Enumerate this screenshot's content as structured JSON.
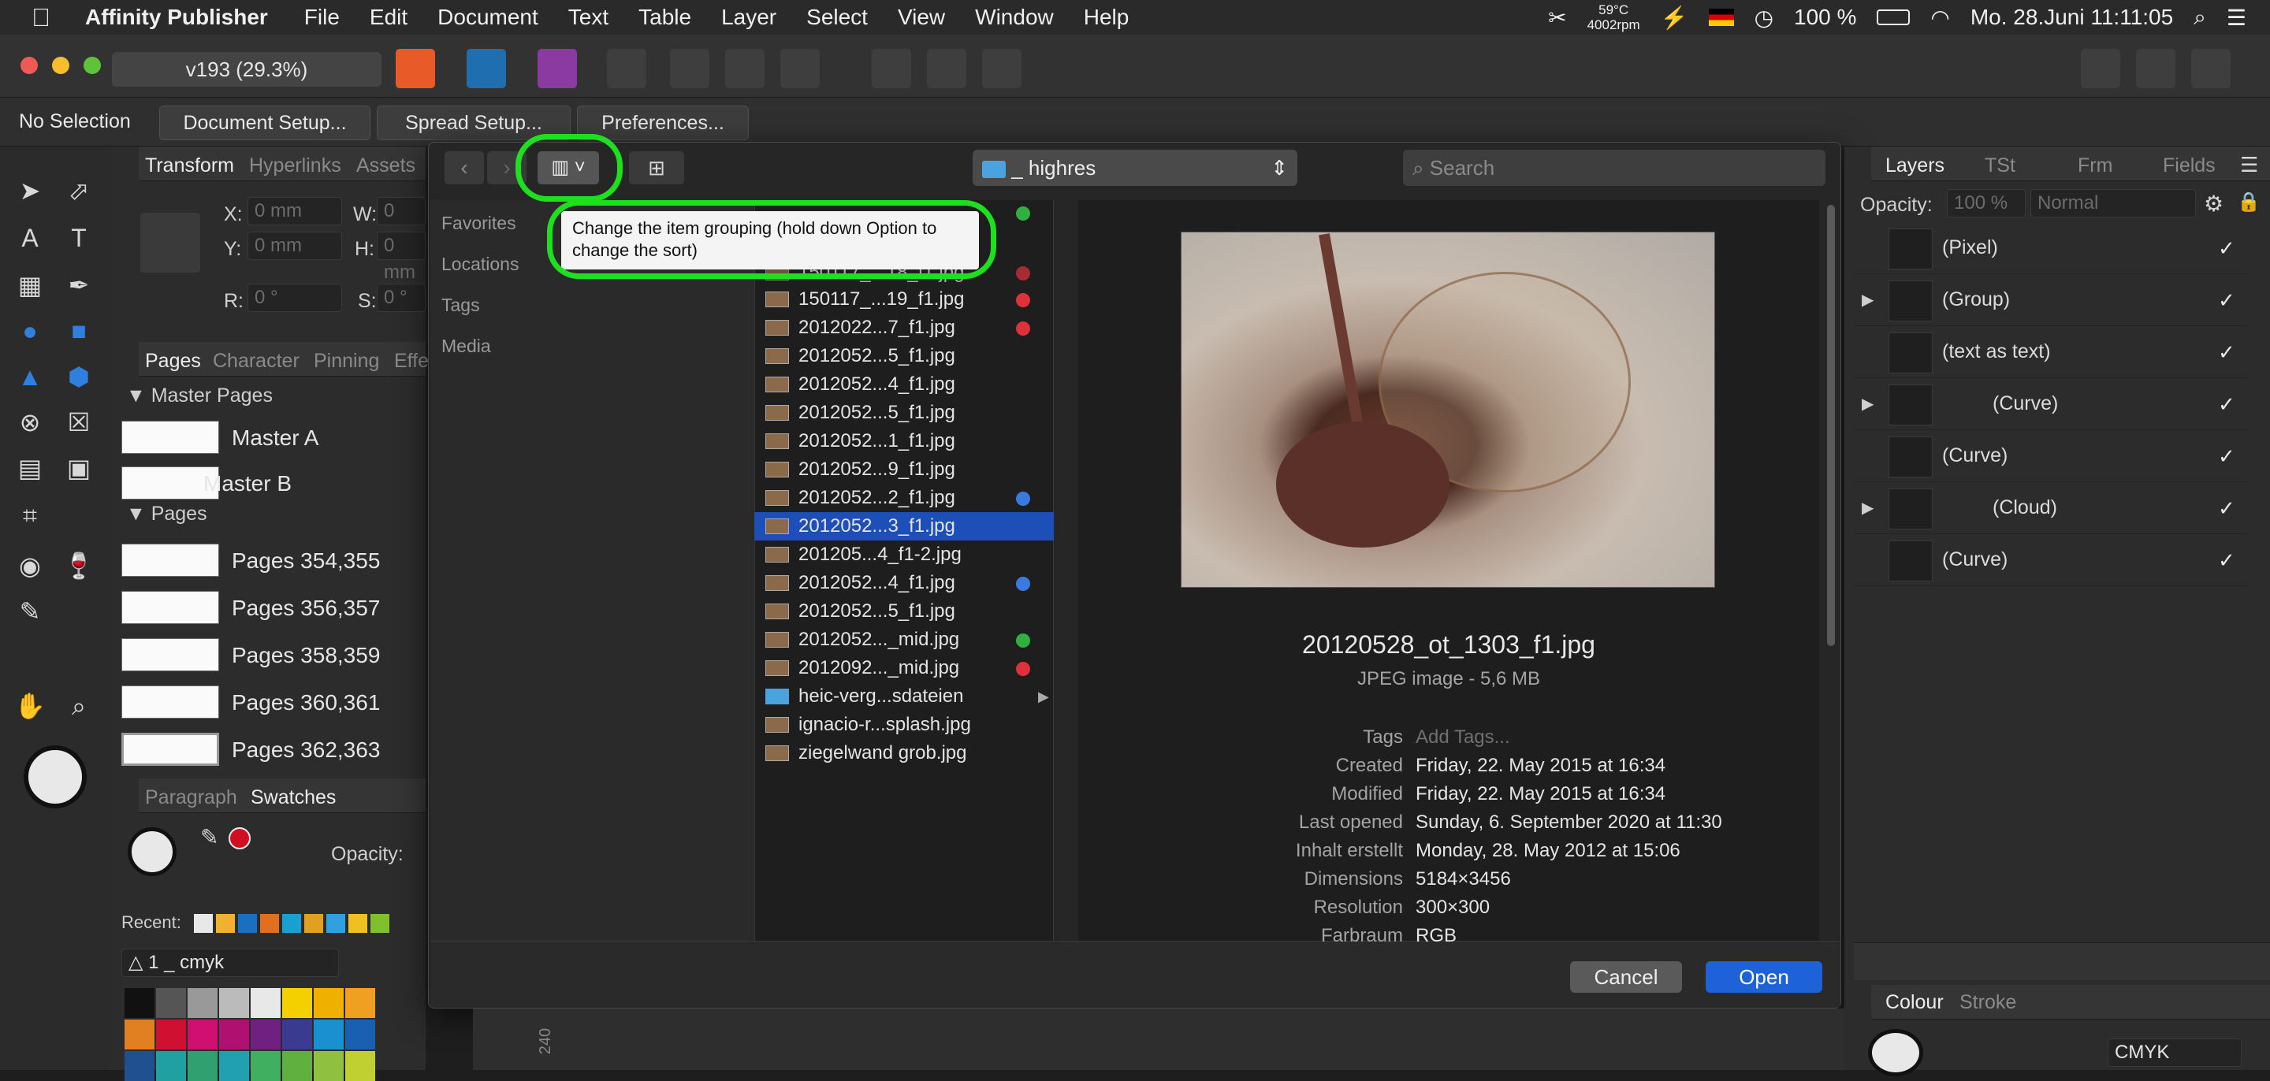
{
  "menubar": {
    "app_name": "Affinity Publisher",
    "items": [
      "File",
      "Edit",
      "Document",
      "Text",
      "Table",
      "Layer",
      "Select",
      "View",
      "Window",
      "Help"
    ],
    "temp": "59°C",
    "rpm": "4002rpm",
    "battery": "100 %",
    "datetime": "Mo. 28.Juni  11:11:05"
  },
  "toolbar": {
    "doc_title": "v193  (29.3%)"
  },
  "context": {
    "selection": "No Selection",
    "document_setup": "Document Setup...",
    "spread_setup": "Spread Setup...",
    "preferences": "Preferences..."
  },
  "transform_panel": {
    "tabs": [
      "Transform",
      "Hyperlinks",
      "Assets"
    ],
    "x_label": "X:",
    "x_value": "0 mm",
    "w_label": "W:",
    "w_value": "0 mm",
    "y_label": "Y:",
    "y_value": "0 mm",
    "h_label": "H:",
    "h_value": "0 mm",
    "r_label": "R:",
    "r_value": "0 °",
    "s_label": "S:",
    "s_value": "0 °"
  },
  "pages_panel": {
    "tabs": [
      "Pages",
      "Character",
      "Pinning",
      "Effe"
    ],
    "master_header": "Master Pages",
    "masters": [
      "Master A",
      "Master B"
    ],
    "pages_header": "Pages",
    "pages": [
      "Pages 354,355",
      "Pages 356,357",
      "Pages 358,359",
      "Pages 360,361",
      "Pages 362,363"
    ]
  },
  "swatches_panel": {
    "tabs": [
      "Paragraph",
      "Swatches"
    ],
    "opacity_label": "Opacity:",
    "recent_label": "Recent:",
    "palette": "1 _ cmyk",
    "recent_colors": [
      "#e8e8e8",
      "#f0b030",
      "#1a6fc0",
      "#e07020",
      "#1aa0d0",
      "#e0a020",
      "#30a0e0",
      "#f0c020",
      "#80c030"
    ],
    "grid_colors": [
      "#111111",
      "#555555",
      "#999999",
      "#bbbbbb",
      "#e8e8e8",
      "#f5d000",
      "#f0b000",
      "#f0a020",
      "#e08020",
      "#d01030",
      "#d01070",
      "#b01070",
      "#702080",
      "#3a3a90",
      "#1a90d0",
      "#1a60b0",
      "#205090",
      "#20a0a0",
      "#30a070",
      "#20a0b0",
      "#40b060",
      "#60b040",
      "#90c040",
      "#c0d030"
    ]
  },
  "dialog": {
    "location": "_ highres",
    "search_placeholder": "Search",
    "tooltip": "Change the item grouping (hold down Option to change the sort)",
    "sidebar": [
      "Favorites",
      "Locations",
      "Tags",
      "Media"
    ],
    "files": [
      {
        "name": "150117_...19_f1.jpg",
        "dot": "#e0303a"
      },
      {
        "name": "2012022...7_f1.jpg",
        "dot": "#e0303a"
      },
      {
        "name": "2012052...5_f1.jpg",
        "dot": ""
      },
      {
        "name": "2012052...4_f1.jpg",
        "dot": ""
      },
      {
        "name": "2012052...5_f1.jpg",
        "dot": ""
      },
      {
        "name": "2012052...1_f1.jpg",
        "dot": ""
      },
      {
        "name": "2012052...9_f1.jpg",
        "dot": ""
      },
      {
        "name": "2012052...2_f1.jpg",
        "dot": "#3a7ae0"
      },
      {
        "name": "2012052...3_f1.jpg",
        "dot": "",
        "selected": true
      },
      {
        "name": "201205...4_f1-2.jpg",
        "dot": ""
      },
      {
        "name": "2012052...4_f1.jpg",
        "dot": "#3a7ae0"
      },
      {
        "name": "2012052...5_f1.jpg",
        "dot": ""
      },
      {
        "name": "2012052..._mid.jpg",
        "dot": "#30b040"
      },
      {
        "name": "2012092..._mid.jpg",
        "dot": "#e0303a"
      },
      {
        "name": "heic-verg...sdateien",
        "dot": "",
        "folder": true
      },
      {
        "name": "ignacio-r...splash.jpg",
        "dot": ""
      },
      {
        "name": "ziegelwand grob.jpg",
        "dot": ""
      }
    ],
    "partial_file": "150117_...18_f1.jpg",
    "preview": {
      "filename": "20120528_ot_1303_f1.jpg",
      "kind": "JPEG image - 5,6 MB",
      "meta": [
        {
          "k": "Tags",
          "v": "Add Tags..."
        },
        {
          "k": "Created",
          "v": "Friday, 22. May 2015 at 16:34"
        },
        {
          "k": "Modified",
          "v": "Friday, 22. May 2015 at 16:34"
        },
        {
          "k": "Last opened",
          "v": "Sunday, 6. September 2020 at 11:30"
        },
        {
          "k": "Inhalt erstellt",
          "v": "Monday, 28. May 2012 at 15:06"
        },
        {
          "k": "Dimensions",
          "v": "5184×3456"
        },
        {
          "k": "Resolution",
          "v": "300×300"
        },
        {
          "k": "Farbraum",
          "v": "RGB"
        }
      ]
    },
    "cancel": "Cancel",
    "open": "Open"
  },
  "layers_panel": {
    "tabs": [
      "Layers",
      "TSt",
      "Frm",
      "Fields"
    ],
    "opacity_label": "Opacity:",
    "opacity_value": "100 %",
    "blend": "Normal",
    "layers": [
      {
        "name": "(Pixel)",
        "expand": false
      },
      {
        "name": "(Group)",
        "expand": true
      },
      {
        "name": "(text as text)",
        "expand": false
      },
      {
        "name": "(Curve)",
        "expand": true
      },
      {
        "name": "(Curve)",
        "expand": false
      },
      {
        "name": "(Cloud)",
        "expand": true
      },
      {
        "name": "(Curve)",
        "expand": false
      }
    ]
  },
  "colour_panel": {
    "tabs": [
      "Colour",
      "Stroke"
    ],
    "model": "CMYK"
  },
  "ruler": {
    "label": "240"
  }
}
